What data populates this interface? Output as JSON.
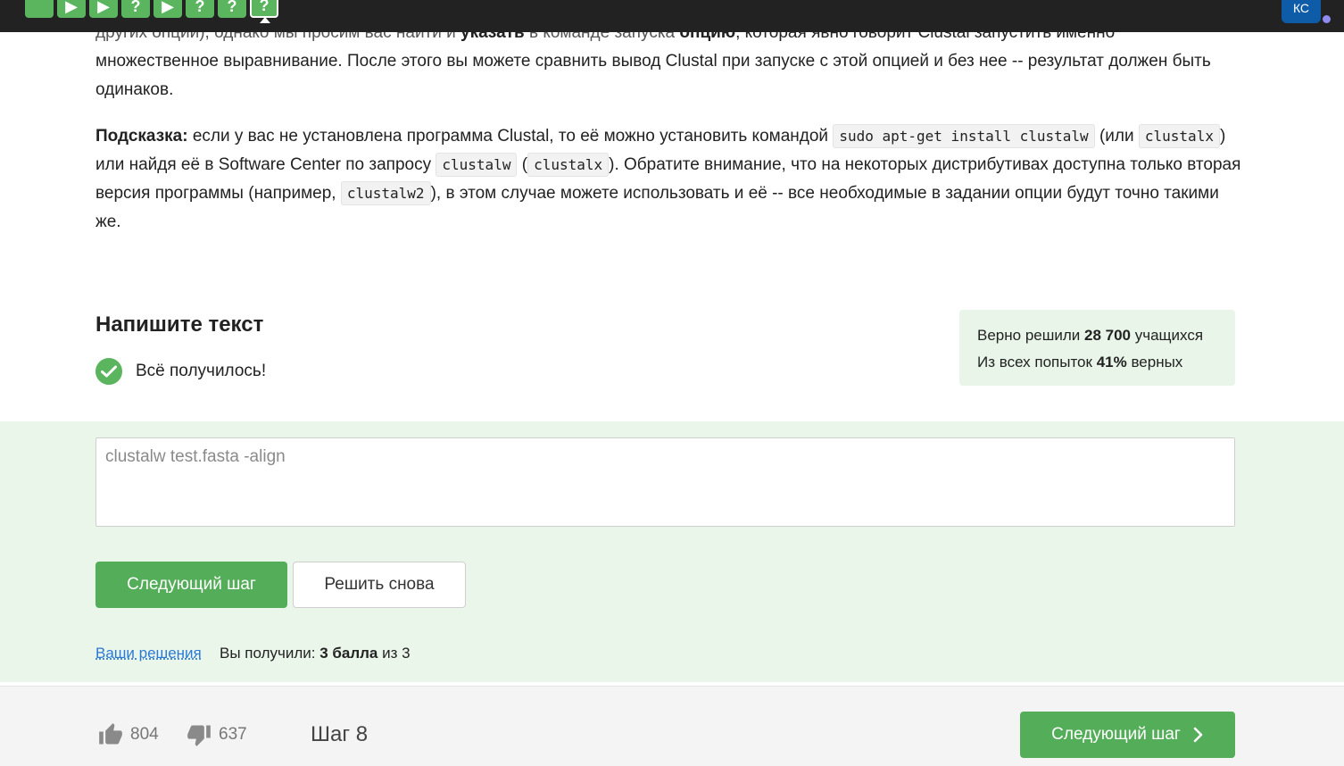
{
  "topbar": {
    "steps": [
      {
        "type": "done",
        "glyph": ""
      },
      {
        "type": "video",
        "glyph": "▶"
      },
      {
        "type": "video",
        "glyph": "▶"
      },
      {
        "type": "quiz",
        "glyph": "?"
      },
      {
        "type": "video",
        "glyph": "▶"
      },
      {
        "type": "quiz",
        "glyph": "?"
      },
      {
        "type": "quiz",
        "glyph": "?"
      },
      {
        "type": "quiz-active",
        "glyph": "?"
      }
    ],
    "avatar_initials": "КС"
  },
  "article": {
    "p1_clipped": "других опций), однако мы просим вас найти и ",
    "p1_bold1": "указать",
    "p1_mid": " в команде запуска ",
    "p1_bold2": "опцию",
    "p1_rest": ", которая явно говорит Clustal запустить именно множественное выравнивание. После этого вы можете сравнить вывод Clustal при запуске с этой опцией и без нее -- результат должен быть одинаков.",
    "hint_label": "Подсказка:",
    "hint_t1": " если у вас не установлена программа Clustal, то её можно установить командой ",
    "hint_code1": "sudo apt-get install clustalw",
    "hint_t2": " (или ",
    "hint_code2": "clustalx",
    "hint_t3": ") или найдя её в Software Center по запросу ",
    "hint_code3": "clustalw",
    "hint_t4": " (",
    "hint_code4": "clustalx",
    "hint_t5": "). Обратите внимание, что на некоторых дистрибутивах доступна только вторая версия программы (например, ",
    "hint_code5": "clustalw2",
    "hint_t6": "), в этом случае можете использовать и её -- все необходимые в задании опции будут точно такими же."
  },
  "task": {
    "title": "Напишите текст",
    "success_text": "Всё получилось!"
  },
  "stats": {
    "line1_prefix": "Верно решили ",
    "line1_value": "28 700",
    "line1_suffix": " учащихся",
    "line2_prefix": "Из всех попыток ",
    "line2_value": "41%",
    "line2_suffix": " верных"
  },
  "answer": {
    "value": "clustalw test.fasta -align"
  },
  "buttons": {
    "next_step": "Следующий шаг",
    "retry": "Решить снова"
  },
  "result": {
    "solutions_link": "Ваши решения",
    "score_prefix": "Вы получили: ",
    "score_value": "3 балла",
    "score_suffix": " из 3"
  },
  "footer": {
    "likes": "804",
    "dislikes": "637",
    "step_label": "Шаг 8",
    "next_step": "Следующий шаг"
  },
  "colors": {
    "accent_green": "#54ad58",
    "light_green_bg": "#ebf6ea",
    "topbar_bg": "#222222",
    "link_blue": "#2b7ad6"
  }
}
